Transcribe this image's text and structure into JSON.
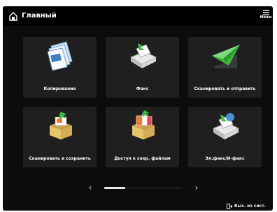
{
  "header": {
    "title": "Главный",
    "home_icon": "home-icon",
    "menu_label": "Меню",
    "menu_icon": "hamburger-menu-icon"
  },
  "tiles": [
    {
      "label": "Копирование",
      "icon": "copy-documents-icon"
    },
    {
      "label": "Факс",
      "icon": "fax-machine-icon"
    },
    {
      "label": "Сканировать и отправить",
      "icon": "scan-send-paper-plane-icon"
    },
    {
      "label": "Сканировать и сохранить",
      "icon": "scan-save-box-icon"
    },
    {
      "label": "Доступ к сохр. файлам",
      "icon": "stored-files-box-icon"
    },
    {
      "label": "Эл.факс/И-факс",
      "icon": "internet-fax-icon"
    }
  ],
  "pager": {
    "prev_icon": "chevron-left-icon",
    "next_icon": "chevron-right-icon",
    "current_page_fraction": 0.27
  },
  "footer": {
    "logout_label": "Вых. из сист.",
    "logout_icon": "logout-icon"
  },
  "colors": {
    "background": "#0c0c0c",
    "tile": "#1f1f1f",
    "accent_green": "#3dbb3d",
    "accent_orange": "#f07a2a"
  }
}
